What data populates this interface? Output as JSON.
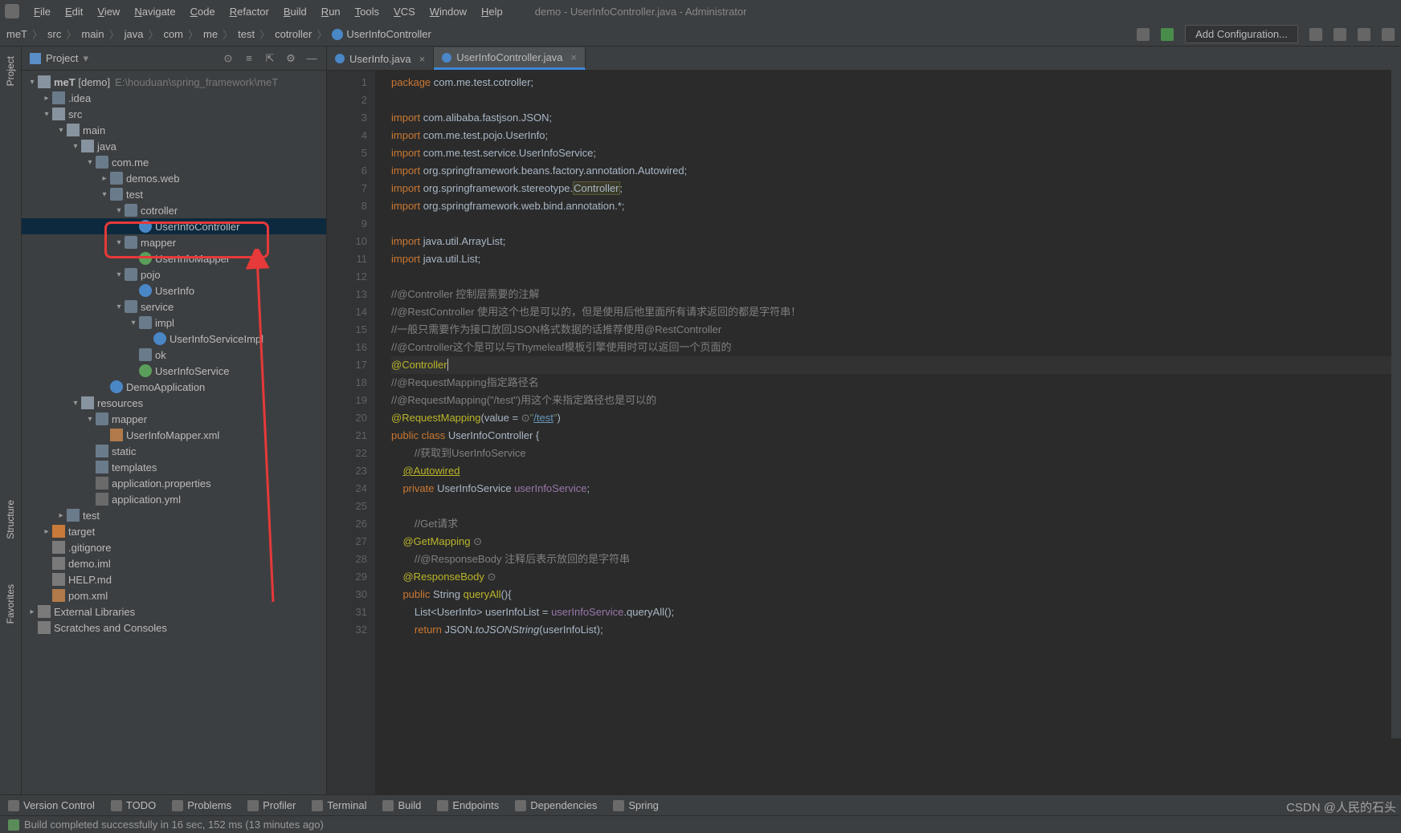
{
  "window_title": "demo - UserInfoController.java - Administrator",
  "menu": [
    "File",
    "Edit",
    "View",
    "Navigate",
    "Code",
    "Refactor",
    "Build",
    "Run",
    "Tools",
    "VCS",
    "Window",
    "Help"
  ],
  "breadcrumbs": [
    "meT",
    "src",
    "main",
    "java",
    "com",
    "me",
    "test",
    "cotroller",
    "UserInfoController"
  ],
  "nav_button": "Add Configuration...",
  "project_panel": {
    "title": "Project"
  },
  "sidebar_tabs": [
    "Project",
    "Structure",
    "Favorites"
  ],
  "tree": {
    "root": {
      "name": "meT",
      "tag": "[demo]",
      "path": "E:\\houduan\\spring_framework\\meT"
    },
    "items": [
      ".idea",
      "src",
      "main",
      "java",
      "com.me",
      "demos.web",
      "test",
      "cotroller",
      "UserInfoController",
      "mapper",
      "UserInfoMapper",
      "pojo",
      "UserInfo",
      "service",
      "impl",
      "UserInfoServiceImpl",
      "ok",
      "UserInfoService",
      "DemoApplication",
      "resources",
      "mapper",
      "UserInfoMapper.xml",
      "static",
      "templates",
      "application.properties",
      "application.yml",
      "test",
      "target",
      ".gitignore",
      "demo.iml",
      "HELP.md",
      "pom.xml",
      "External Libraries",
      "Scratches and Consoles"
    ]
  },
  "tabs": [
    {
      "name": "UserInfo.java",
      "active": false
    },
    {
      "name": "UserInfoController.java",
      "active": true
    }
  ],
  "code_lines": [
    {
      "n": 1,
      "t": "package com.me.test.cotroller;",
      "k": "pkg"
    },
    {
      "n": 2,
      "t": ""
    },
    {
      "n": 3,
      "t": "import com.alibaba.fastjson.JSON;",
      "k": "imp"
    },
    {
      "n": 4,
      "t": "import com.me.test.pojo.UserInfo;",
      "k": "imp"
    },
    {
      "n": 5,
      "t": "import com.me.test.service.UserInfoService;",
      "k": "imp"
    },
    {
      "n": 6,
      "t": "import org.springframework.beans.factory.annotation.Autowired;",
      "k": "imp"
    },
    {
      "n": 7,
      "t": "import org.springframework.stereotype.Controller;",
      "k": "imp-hl"
    },
    {
      "n": 8,
      "t": "import org.springframework.web.bind.annotation.*;",
      "k": "imp"
    },
    {
      "n": 9,
      "t": ""
    },
    {
      "n": 10,
      "t": "import java.util.ArrayList;",
      "k": "imp"
    },
    {
      "n": 11,
      "t": "import java.util.List;",
      "k": "imp"
    },
    {
      "n": 12,
      "t": ""
    },
    {
      "n": 13,
      "t": "//@Controller 控制层需要的注解",
      "k": "cmt"
    },
    {
      "n": 14,
      "t": "//@RestController 使用这个也是可以的，但是使用后他里面所有请求返回的都是字符串！",
      "k": "cmt"
    },
    {
      "n": 15,
      "t": "//一般只需要作为接口放回JSON格式数据的话推荐使用@RestController",
      "k": "cmt"
    },
    {
      "n": 16,
      "t": "//@Controller这个是可以与Thymeleaf模板引擎使用时可以返回一个页面的",
      "k": "cmt"
    },
    {
      "n": 17,
      "t": "@Controller",
      "k": "ann-caret"
    },
    {
      "n": 18,
      "t": "//@RequestMapping指定路径名",
      "k": "cmt"
    },
    {
      "n": 19,
      "t": "//@RequestMapping(\"/test\")用这个来指定路径也是可以的",
      "k": "cmt"
    },
    {
      "n": 20,
      "t": "@RequestMapping(value = \"/test\")",
      "k": "ann-map"
    },
    {
      "n": 21,
      "t": "public class UserInfoController {",
      "k": "cls"
    },
    {
      "n": 22,
      "t": "    //获取到UserInfoService",
      "k": "cmt"
    },
    {
      "n": 23,
      "t": "    @Autowired",
      "k": "ann-u"
    },
    {
      "n": 24,
      "t": "    private UserInfoService userInfoService;",
      "k": "fld"
    },
    {
      "n": 25,
      "t": ""
    },
    {
      "n": 26,
      "t": "    //Get请求",
      "k": "cmt"
    },
    {
      "n": 27,
      "t": "    @GetMapping",
      "k": "ann"
    },
    {
      "n": 28,
      "t": "    //@ResponseBody 注释后表示放回的是字符串",
      "k": "cmt"
    },
    {
      "n": 29,
      "t": "    @ResponseBody",
      "k": "ann"
    },
    {
      "n": 30,
      "t": "    public String queryAll(){",
      "k": "mth"
    },
    {
      "n": 31,
      "t": "        List<UserInfo> userInfoList = userInfoService.queryAll();",
      "k": "stmt"
    },
    {
      "n": 32,
      "t": "        return JSON.toJSONString(userInfoList);",
      "k": "ret"
    }
  ],
  "bottom": [
    "Version Control",
    "TODO",
    "Problems",
    "Profiler",
    "Terminal",
    "Build",
    "Endpoints",
    "Dependencies",
    "Spring"
  ],
  "status": "Build completed successfully in 16 sec, 152 ms (13 minutes ago)",
  "watermark": "CSDN @人民的石头"
}
